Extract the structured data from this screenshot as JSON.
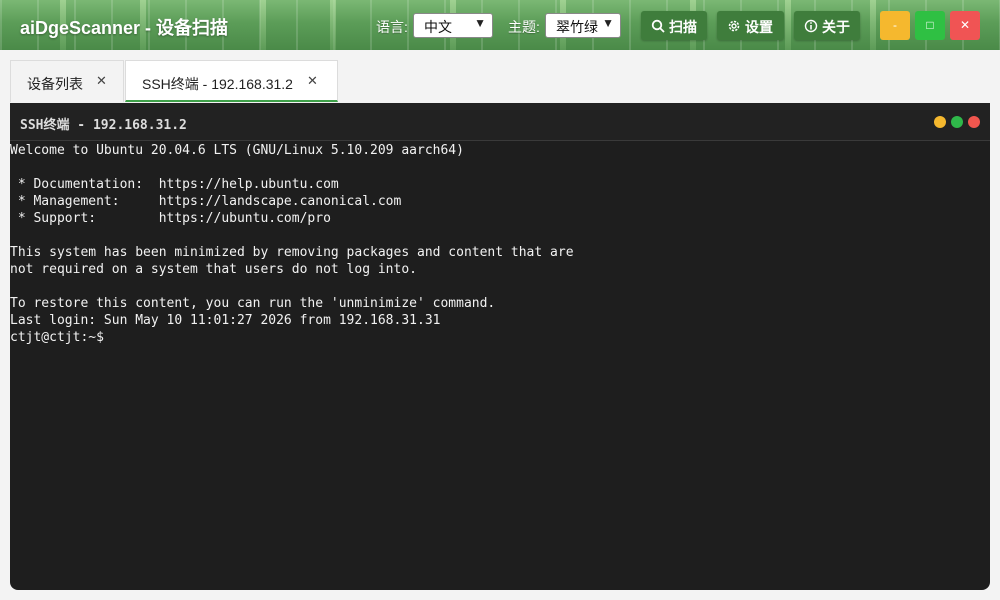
{
  "app": {
    "title": "aiDgeScanner - 设备扫描",
    "language_label": "语言:",
    "language_value": "中文",
    "theme_label": "主题:",
    "theme_value": "翠竹绿",
    "scan_label": "扫描",
    "settings_label": "设置",
    "about_label": "关于",
    "minimize_label": "-",
    "maximize_label": "□",
    "close_label": "✕"
  },
  "tabs": [
    {
      "label": "设备列表",
      "active": false
    },
    {
      "label": "SSH终端 - 192.168.31.2",
      "active": true
    }
  ],
  "terminal": {
    "title": "SSH终端 - 192.168.31.2",
    "lines": [
      "Welcome to Ubuntu 20.04.6 LTS (GNU/Linux 5.10.209 aarch64)",
      "",
      " * Documentation:  https://help.ubuntu.com",
      " * Management:     https://landscape.canonical.com",
      " * Support:        https://ubuntu.com/pro",
      "",
      "This system has been minimized by removing packages and content that are",
      "not required on a system that users do not log into.",
      "",
      "To restore this content, you can run the 'unminimize' command.",
      "Last login: Sun May 10 11:01:27 2026 from 192.168.31.31",
      "ctjt@ctjt:~$"
    ]
  },
  "colors": {
    "accent": "#3fa14a",
    "dot_yellow": "#f5b82e",
    "dot_green": "#2fb84a",
    "dot_red": "#f0564e",
    "win_min": "#f5b82e",
    "win_max": "#2fc043",
    "win_close": "#f05454"
  },
  "icons": {
    "scan": "search-icon",
    "settings": "gear-icon",
    "about": "info-icon"
  }
}
